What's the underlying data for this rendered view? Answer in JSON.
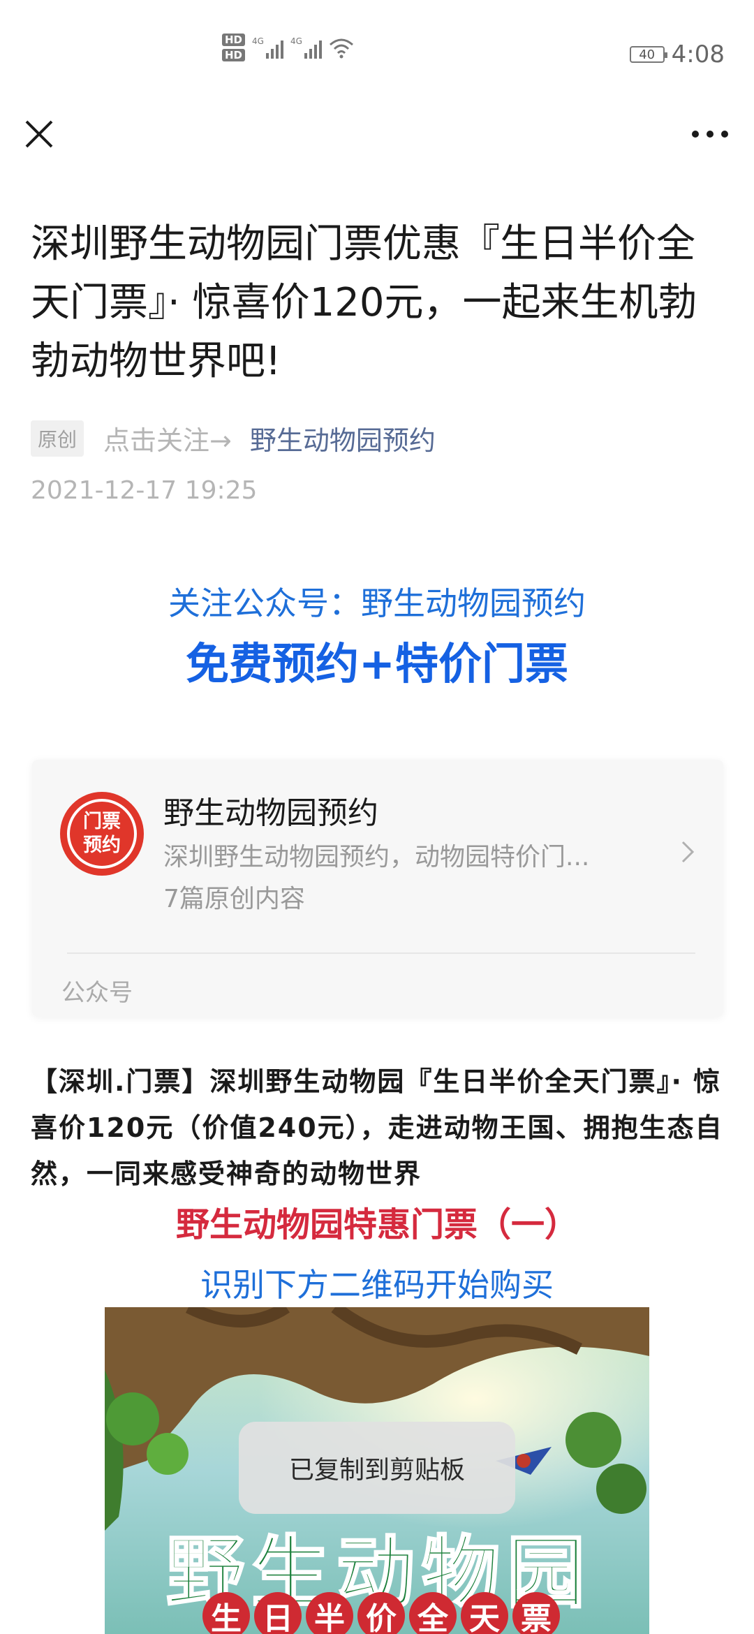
{
  "status_bar": {
    "hd1": "HD",
    "hd2": "HD",
    "net1": "4G",
    "net2": "4G",
    "battery": "40",
    "time": "4:08"
  },
  "article": {
    "title": "深圳野生动物园门票优惠『生日半价全天门票』· 惊喜价120元，一起来生机勃勃动物世界吧!",
    "tag_original": "原创",
    "follow_prompt": "点击关注→",
    "account_name": "野生动物园预约",
    "date": "2021-12-17 19:25",
    "follow_line": "关注公众号：野生动物园预约",
    "promo_line": "免费预约+特价门票",
    "body": "【深圳.门票】深圳野生动物园『生日半价全天门票』· 惊喜价120元（价值240元），走进动物王国、拥抱生态自然，一同来感受神奇的动物世界",
    "red_heading": "野生动物园特惠门票（一）",
    "qr_prompt": "识别下方二维码开始购买"
  },
  "account_card": {
    "avatar_line1": "门票",
    "avatar_line2": "预约",
    "name": "野生动物园预约",
    "description": "深圳野生动物园预约，动物园特价门...",
    "count": "7篇原创内容",
    "footer": "公众号"
  },
  "poster": {
    "title": "野生动物园",
    "subtitle": [
      "生",
      "日",
      "半",
      "价",
      "全",
      "天",
      "票"
    ]
  },
  "toast": {
    "text": "已复制到剪贴板"
  },
  "icons": [
    "close-icon",
    "more-icon",
    "chevron-right-icon",
    "signal-icon",
    "wifi-icon",
    "battery-icon"
  ],
  "colors": {
    "link": "#576b95",
    "follow_blue": "#1e6fd9",
    "promo_blue": "#1561e3",
    "heading_red": "#d52a3e",
    "avatar_red": "#e0362a"
  }
}
